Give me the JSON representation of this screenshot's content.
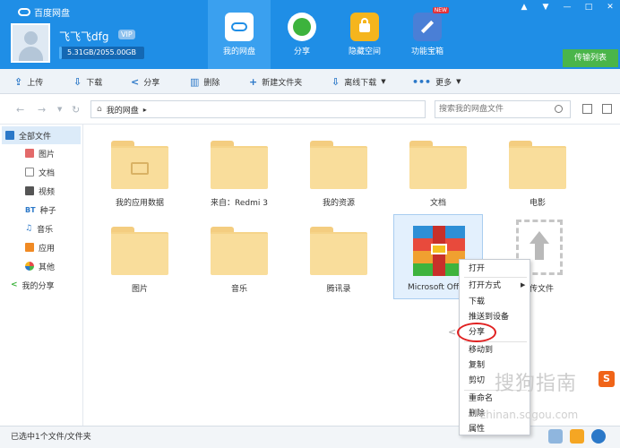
{
  "app": {
    "title": "百度网盘"
  },
  "user": {
    "name": "飞飞飞dfg",
    "vip": "VIP",
    "quota": "5.31GB/2055.00GB",
    "quota_fraction": 0.0026
  },
  "nav": [
    {
      "label": "我的网盘"
    },
    {
      "label": "分享"
    },
    {
      "label": "隐藏空间"
    },
    {
      "label": "功能宝箱",
      "badge": "NEW"
    }
  ],
  "transfer": "传输列表",
  "toolbar": {
    "upload": "上传",
    "download": "下载",
    "share": "分享",
    "delete": "删除",
    "new_folder": "新建文件夹",
    "offline": "离线下载",
    "more": "更多"
  },
  "address": {
    "path": "我的网盘",
    "search_placeholder": "搜索我的网盘文件"
  },
  "sidebar": [
    {
      "label": "全部文件"
    },
    {
      "label": "图片"
    },
    {
      "label": "文档"
    },
    {
      "label": "视频"
    },
    {
      "label": "种子",
      "prefix": "BT"
    },
    {
      "label": "音乐"
    },
    {
      "label": "应用"
    },
    {
      "label": "其他"
    },
    {
      "label": "我的分享"
    }
  ],
  "files": [
    {
      "name": "我的应用数据"
    },
    {
      "name": "来自：Redmi 3"
    },
    {
      "name": "我的资源"
    },
    {
      "name": "文档"
    },
    {
      "name": "电影"
    },
    {
      "name": "图片"
    },
    {
      "name": "音乐"
    },
    {
      "name": "腾讯录"
    },
    {
      "name": "Microsoft Office"
    },
    {
      "name": "上传文件"
    }
  ],
  "context_menu": [
    "打开",
    "打开方式",
    "下载",
    "推送到设备",
    "分享",
    "移动到",
    "复制",
    "剪切",
    "重命名",
    "删除",
    "属性"
  ],
  "status": "已选中1个文件/文件夹",
  "watermark": {
    "text": "搜狗指南",
    "logo": "S",
    "url": "zhinan.sogou.com"
  },
  "colors": {
    "header": "#1f8ee6",
    "accent": "#2b78c8",
    "transfer": "#4ab54a",
    "circle": "#e02020"
  }
}
